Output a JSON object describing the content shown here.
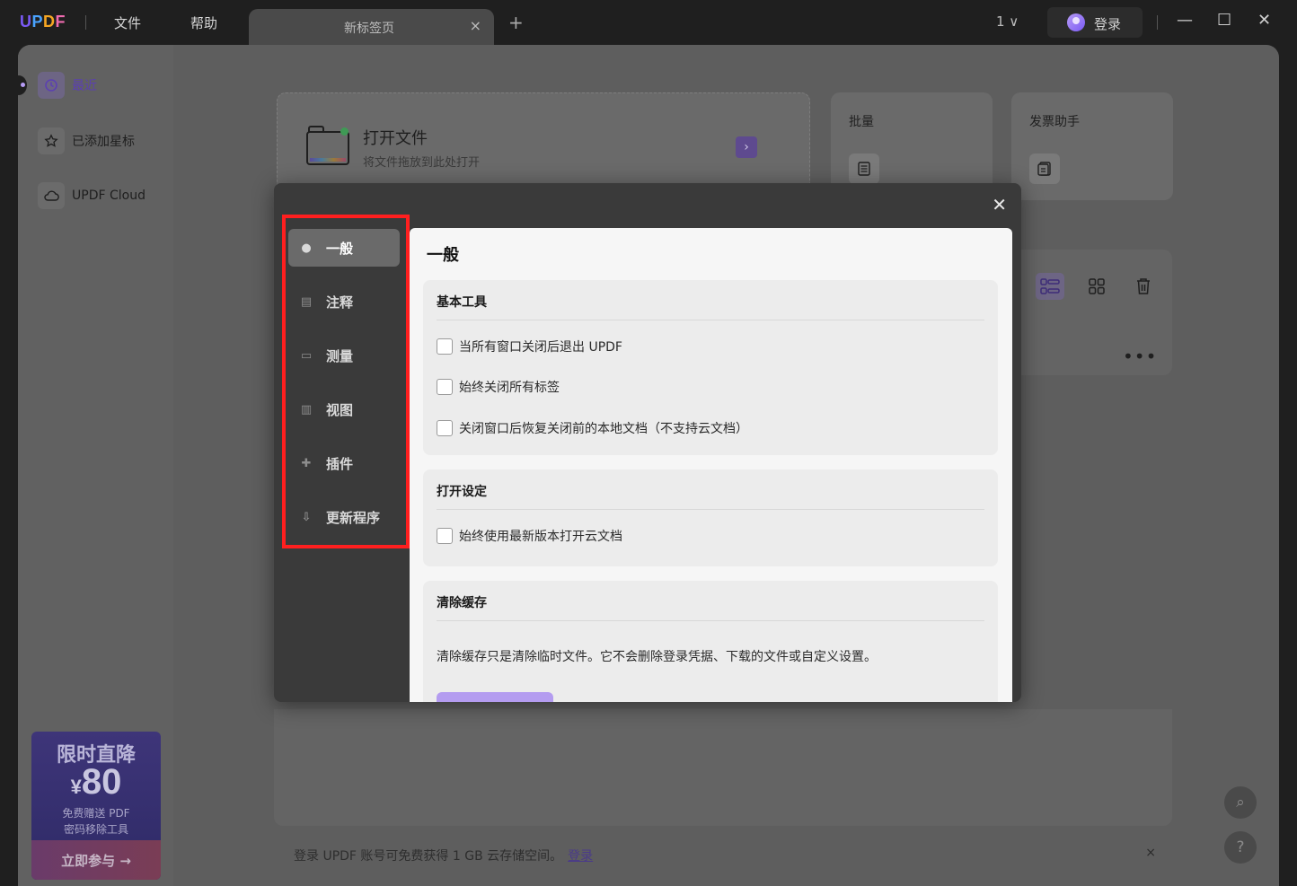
{
  "titlebar": {
    "logo": [
      "U",
      "P",
      "D",
      "F"
    ],
    "menu": [
      "文件",
      "帮助"
    ],
    "tab_title": "新标签页",
    "tab_close": "×",
    "tab_add": "+",
    "page_selector": "1 ∨",
    "login_label": "登录",
    "win_min": "—",
    "win_max": "☐",
    "win_close": "✕"
  },
  "sidebar": {
    "items": [
      {
        "label": "最近",
        "icon": "clock-icon"
      },
      {
        "label": "已添加星标",
        "icon": "star-icon"
      },
      {
        "label": "UPDF Cloud",
        "icon": "cloud-icon"
      }
    ]
  },
  "promo": {
    "title": "限时直降",
    "currency": "¥",
    "price": "80",
    "sub_line1": "免费赠送 PDF",
    "sub_line2": "密码移除工具",
    "join_label": "立即参与 →"
  },
  "main": {
    "open_title": "打开文件",
    "open_sub": "将文件拖放到此处打开",
    "open_arrow": "›",
    "tools": [
      {
        "title": "批量",
        "icon": "batch-icon"
      },
      {
        "title": "发票助手",
        "icon": "invoice-icon"
      }
    ],
    "more": "•••"
  },
  "notice": {
    "text": "登录 UPDF 账号可免费获得 1 GB 云存储空间。",
    "link": "登录",
    "close": "×"
  },
  "fab": {
    "search": "⌕",
    "help": "?"
  },
  "modal": {
    "close": "✕",
    "nav": [
      {
        "label": "一般",
        "icon": "general-icon",
        "glyph": "●"
      },
      {
        "label": "注释",
        "icon": "annotation-icon",
        "glyph": "▤"
      },
      {
        "label": "测量",
        "icon": "ruler-icon",
        "glyph": "▭"
      },
      {
        "label": "视图",
        "icon": "view-icon",
        "glyph": "▥"
      },
      {
        "label": "插件",
        "icon": "puzzle-icon",
        "glyph": "✚"
      },
      {
        "label": "更新程序",
        "icon": "download-icon",
        "glyph": "⇩"
      }
    ],
    "content": {
      "title": "一般",
      "basic_tools": {
        "title": "基本工具",
        "options": [
          "当所有窗口关闭后退出 UPDF",
          "始终关闭所有标签",
          " 关闭窗口后恢复关闭前的本地文档（不支持云文档）"
        ]
      },
      "open_settings": {
        "title": "打开设定",
        "options": [
          "始终使用最新版本打开云文档"
        ]
      },
      "clear_cache": {
        "title": "清除缓存",
        "description": "清除缓存只是清除临时文件。它不会删除登录凭据、下载的文件或自定义设置。"
      }
    }
  }
}
